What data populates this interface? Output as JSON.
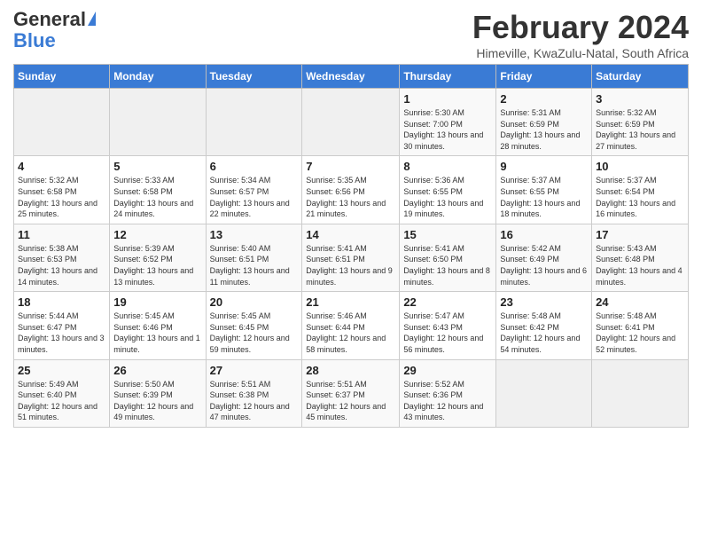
{
  "header": {
    "logo_general": "General",
    "logo_blue": "Blue",
    "title": "February 2024",
    "location": "Himeville, KwaZulu-Natal, South Africa"
  },
  "days_of_week": [
    "Sunday",
    "Monday",
    "Tuesday",
    "Wednesday",
    "Thursday",
    "Friday",
    "Saturday"
  ],
  "weeks": [
    [
      {
        "day": "",
        "info": ""
      },
      {
        "day": "",
        "info": ""
      },
      {
        "day": "",
        "info": ""
      },
      {
        "day": "",
        "info": ""
      },
      {
        "day": "1",
        "info": "Sunrise: 5:30 AM\nSunset: 7:00 PM\nDaylight: 13 hours and 30 minutes."
      },
      {
        "day": "2",
        "info": "Sunrise: 5:31 AM\nSunset: 6:59 PM\nDaylight: 13 hours and 28 minutes."
      },
      {
        "day": "3",
        "info": "Sunrise: 5:32 AM\nSunset: 6:59 PM\nDaylight: 13 hours and 27 minutes."
      }
    ],
    [
      {
        "day": "4",
        "info": "Sunrise: 5:32 AM\nSunset: 6:58 PM\nDaylight: 13 hours and 25 minutes."
      },
      {
        "day": "5",
        "info": "Sunrise: 5:33 AM\nSunset: 6:58 PM\nDaylight: 13 hours and 24 minutes."
      },
      {
        "day": "6",
        "info": "Sunrise: 5:34 AM\nSunset: 6:57 PM\nDaylight: 13 hours and 22 minutes."
      },
      {
        "day": "7",
        "info": "Sunrise: 5:35 AM\nSunset: 6:56 PM\nDaylight: 13 hours and 21 minutes."
      },
      {
        "day": "8",
        "info": "Sunrise: 5:36 AM\nSunset: 6:55 PM\nDaylight: 13 hours and 19 minutes."
      },
      {
        "day": "9",
        "info": "Sunrise: 5:37 AM\nSunset: 6:55 PM\nDaylight: 13 hours and 18 minutes."
      },
      {
        "day": "10",
        "info": "Sunrise: 5:37 AM\nSunset: 6:54 PM\nDaylight: 13 hours and 16 minutes."
      }
    ],
    [
      {
        "day": "11",
        "info": "Sunrise: 5:38 AM\nSunset: 6:53 PM\nDaylight: 13 hours and 14 minutes."
      },
      {
        "day": "12",
        "info": "Sunrise: 5:39 AM\nSunset: 6:52 PM\nDaylight: 13 hours and 13 minutes."
      },
      {
        "day": "13",
        "info": "Sunrise: 5:40 AM\nSunset: 6:51 PM\nDaylight: 13 hours and 11 minutes."
      },
      {
        "day": "14",
        "info": "Sunrise: 5:41 AM\nSunset: 6:51 PM\nDaylight: 13 hours and 9 minutes."
      },
      {
        "day": "15",
        "info": "Sunrise: 5:41 AM\nSunset: 6:50 PM\nDaylight: 13 hours and 8 minutes."
      },
      {
        "day": "16",
        "info": "Sunrise: 5:42 AM\nSunset: 6:49 PM\nDaylight: 13 hours and 6 minutes."
      },
      {
        "day": "17",
        "info": "Sunrise: 5:43 AM\nSunset: 6:48 PM\nDaylight: 13 hours and 4 minutes."
      }
    ],
    [
      {
        "day": "18",
        "info": "Sunrise: 5:44 AM\nSunset: 6:47 PM\nDaylight: 13 hours and 3 minutes."
      },
      {
        "day": "19",
        "info": "Sunrise: 5:45 AM\nSunset: 6:46 PM\nDaylight: 13 hours and 1 minute."
      },
      {
        "day": "20",
        "info": "Sunrise: 5:45 AM\nSunset: 6:45 PM\nDaylight: 12 hours and 59 minutes."
      },
      {
        "day": "21",
        "info": "Sunrise: 5:46 AM\nSunset: 6:44 PM\nDaylight: 12 hours and 58 minutes."
      },
      {
        "day": "22",
        "info": "Sunrise: 5:47 AM\nSunset: 6:43 PM\nDaylight: 12 hours and 56 minutes."
      },
      {
        "day": "23",
        "info": "Sunrise: 5:48 AM\nSunset: 6:42 PM\nDaylight: 12 hours and 54 minutes."
      },
      {
        "day": "24",
        "info": "Sunrise: 5:48 AM\nSunset: 6:41 PM\nDaylight: 12 hours and 52 minutes."
      }
    ],
    [
      {
        "day": "25",
        "info": "Sunrise: 5:49 AM\nSunset: 6:40 PM\nDaylight: 12 hours and 51 minutes."
      },
      {
        "day": "26",
        "info": "Sunrise: 5:50 AM\nSunset: 6:39 PM\nDaylight: 12 hours and 49 minutes."
      },
      {
        "day": "27",
        "info": "Sunrise: 5:51 AM\nSunset: 6:38 PM\nDaylight: 12 hours and 47 minutes."
      },
      {
        "day": "28",
        "info": "Sunrise: 5:51 AM\nSunset: 6:37 PM\nDaylight: 12 hours and 45 minutes."
      },
      {
        "day": "29",
        "info": "Sunrise: 5:52 AM\nSunset: 6:36 PM\nDaylight: 12 hours and 43 minutes."
      },
      {
        "day": "",
        "info": ""
      },
      {
        "day": "",
        "info": ""
      }
    ]
  ]
}
